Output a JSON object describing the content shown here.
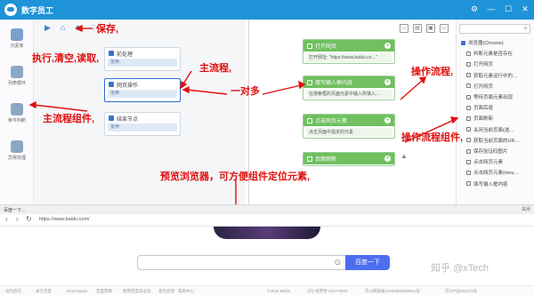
{
  "app": {
    "title": "数字员工",
    "controls": [
      "⚙",
      "—",
      "☐",
      "✕"
    ]
  },
  "left_toolbar": {
    "items": [
      {
        "label": "元素库"
      },
      {
        "label": "列表循环"
      },
      {
        "label": "条件判断"
      },
      {
        "label": "异常处理"
      }
    ]
  },
  "main_flow": {
    "nodes": [
      {
        "title": "前处理",
        "sub": "批参:"
      },
      {
        "title": "网页操作",
        "sub": "批参:"
      },
      {
        "title": "结束节点",
        "sub": "批参:"
      }
    ]
  },
  "op_flow": {
    "nodes": [
      {
        "title": "打开网页",
        "body": "打开网址: \"https://www.baidu.co…\""
      },
      {
        "title": "填写输入框内容",
        "body": "在搜索框的页面元素中输入所填入…"
      },
      {
        "title": "点击网页元素",
        "body": "点击页面中指定的元素"
      },
      {
        "title": "页面刷新",
        "body": ""
      }
    ]
  },
  "right_panel": {
    "items": [
      {
        "label": "浏览器(Chrome)",
        "head": true
      },
      {
        "label": "判断元素是否存在"
      },
      {
        "label": "打开网页"
      },
      {
        "label": "获取元素运行中的…"
      },
      {
        "label": "打开网页"
      },
      {
        "label": "等待页面元素出现"
      },
      {
        "label": "页面后退"
      },
      {
        "label": "页面刷新"
      },
      {
        "label": "关闭当前页面(选…"
      },
      {
        "label": "获取当前页面的UR…"
      },
      {
        "label": "保存验证码图片"
      },
      {
        "label": "点击网页元素"
      },
      {
        "label": "点击网页元素(mou…"
      },
      {
        "label": "填写输入框内容"
      }
    ]
  },
  "annotations": {
    "save": "保存,",
    "exec": "执行,清空,读取,",
    "main_flow": "主流程,",
    "one_to_many": "一对多",
    "op_flow": "操作流程,",
    "main_components": "主流程组件,",
    "op_components": "操作流程组件,",
    "preview": "预览浏览器，可方便组件定位元素,"
  },
  "browser": {
    "tab": "百度一下...",
    "close": "关闭",
    "url": "https://www.baidu.com/",
    "search_button": "百度一下",
    "footer": [
      "设为首页",
      "关于百度",
      "About Baidu",
      "百度营销",
      "使用百度前必读",
      "意见反馈",
      "帮助中心",
      "©2020 Baidu",
      "(京)-经营性-2017-0020",
      "京公网安备11000002000001号",
      "京ICP证030173号"
    ]
  },
  "watermark": "知乎 @xTech"
}
